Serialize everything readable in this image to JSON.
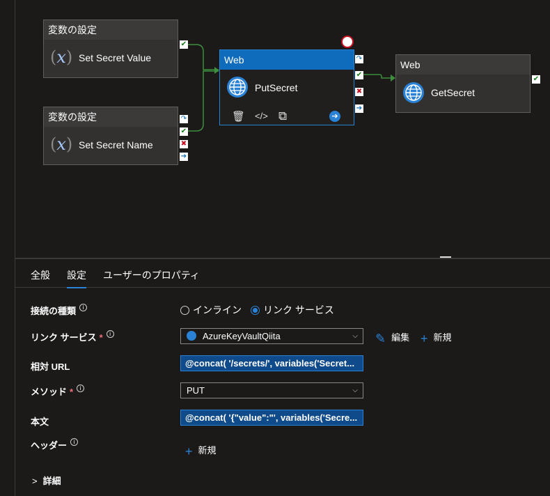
{
  "canvas": {
    "activities": [
      {
        "header": "変数の設定",
        "name": "Set Secret Value"
      },
      {
        "header": "変数の設定",
        "name": "Set Secret Name"
      },
      {
        "header": "Web",
        "name": "PutSecret"
      },
      {
        "header": "Web",
        "name": "GetSecret"
      }
    ],
    "icons": {
      "variable": "(𝑥)",
      "globe": "globe-icon",
      "delete": "🗑",
      "code": "</>",
      "copy": "⧉",
      "run": "➔"
    },
    "ports": {
      "success": "✔",
      "fail": "✖",
      "complete": "➔",
      "skip": "↷"
    }
  },
  "tabs": [
    "全般",
    "設定",
    "ユーザーのプロパティ"
  ],
  "form": {
    "connection_type": {
      "label": "接続の種類",
      "info": "i",
      "options": [
        "インライン",
        "リンク サービス"
      ],
      "selected": "リンク サービス"
    },
    "linked_service": {
      "label": "リンク サービス",
      "required": "*",
      "info": "i",
      "value": "AzureKeyVaultQiita",
      "edit": "編集",
      "new": "新規"
    },
    "relative_url": {
      "label": "相対 URL",
      "value": "@concat( '/secrets/', variables('Secret..."
    },
    "method": {
      "label": "メソッド",
      "required": "*",
      "info": "i",
      "value": "PUT"
    },
    "body": {
      "label": "本文",
      "value": "@concat( '{\"value\":\"', variables('Secre..."
    },
    "headers": {
      "label": "ヘッダー",
      "info": "i",
      "new": "新規"
    },
    "advanced": {
      "label": "詳細"
    }
  },
  "colors": {
    "accent": "#2a82d6",
    "success": "#107c10",
    "fail": "#c50f1f",
    "background": "#1b1a19"
  }
}
